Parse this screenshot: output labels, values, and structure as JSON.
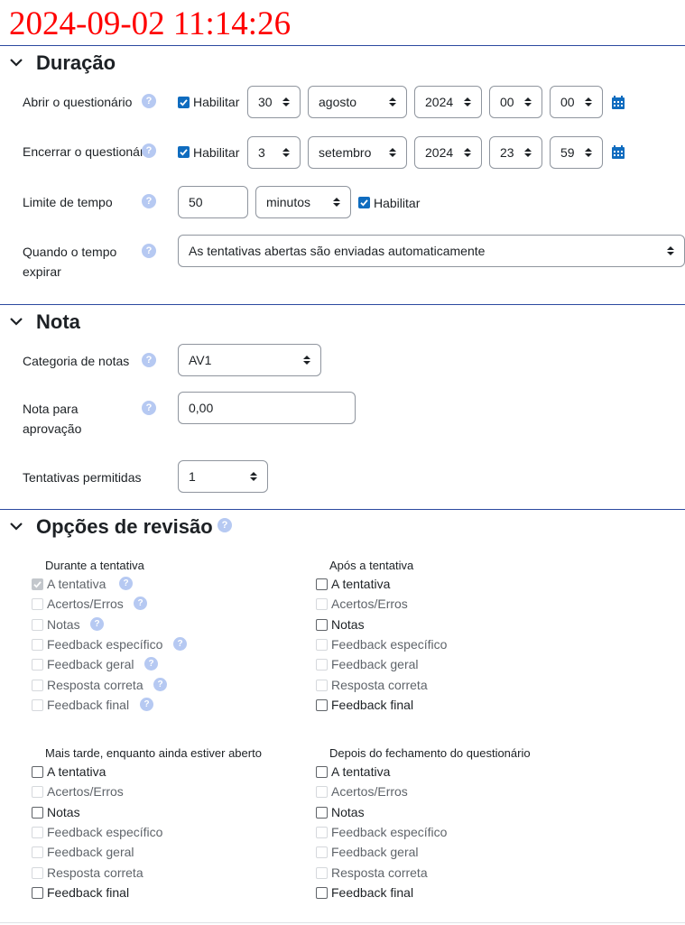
{
  "timestamp": "2024-09-02 11:14:26",
  "colors": {
    "timestamp": "#ff0000",
    "accent": "#0f6cbf",
    "divider": "#2c4aa0",
    "help_icon": "#b6c9f2"
  },
  "duracao": {
    "title": "Duração",
    "abrir": {
      "label": "Abrir o questionário",
      "enable_checked": true,
      "enable_label": "Habilitar",
      "day": "30",
      "month": "agosto",
      "year": "2024",
      "hour": "00",
      "minute": "00"
    },
    "encerrar": {
      "label": "Encerrar o questionário",
      "enable_checked": true,
      "enable_label": "Habilitar",
      "day": "3",
      "month": "setembro",
      "year": "2024",
      "hour": "23",
      "minute": "59"
    },
    "limite": {
      "label": "Limite de tempo",
      "value": "50",
      "unit": "minutos",
      "enable_checked": true,
      "enable_label": "Habilitar"
    },
    "expirar": {
      "label": "Quando o tempo expirar",
      "value": "As tentativas abertas são enviadas automaticamente"
    }
  },
  "nota": {
    "title": "Nota",
    "categoria": {
      "label": "Categoria de notas",
      "value": "AV1"
    },
    "aprovacao": {
      "label": "Nota para aprovação",
      "value": "0,00"
    },
    "tentativas": {
      "label": "Tentativas permitidas",
      "value": "1"
    }
  },
  "revisao": {
    "title": "Opções de revisão",
    "groups": [
      {
        "title": "Durante a tentativa",
        "items": [
          {
            "label": "A tentativa",
            "state": "checked-disabled",
            "help": true
          },
          {
            "label": "Acertos/Erros",
            "state": "disabled",
            "help": true
          },
          {
            "label": "Notas",
            "state": "disabled",
            "help": true
          },
          {
            "label": "Feedback específico",
            "state": "disabled",
            "help": true
          },
          {
            "label": "Feedback geral",
            "state": "disabled",
            "help": true
          },
          {
            "label": "Resposta correta",
            "state": "disabled",
            "help": true
          },
          {
            "label": "Feedback final",
            "state": "disabled",
            "help": true
          }
        ]
      },
      {
        "title": "Após a tentativa",
        "items": [
          {
            "label": "A tentativa",
            "state": "unchecked"
          },
          {
            "label": "Acertos/Erros",
            "state": "disabled"
          },
          {
            "label": "Notas",
            "state": "unchecked"
          },
          {
            "label": "Feedback específico",
            "state": "disabled"
          },
          {
            "label": "Feedback geral",
            "state": "disabled"
          },
          {
            "label": "Resposta correta",
            "state": "disabled"
          },
          {
            "label": "Feedback final",
            "state": "unchecked"
          }
        ]
      },
      {
        "title": "Mais tarde, enquanto ainda estiver aberto",
        "items": [
          {
            "label": "A tentativa",
            "state": "unchecked"
          },
          {
            "label": "Acertos/Erros",
            "state": "disabled"
          },
          {
            "label": "Notas",
            "state": "unchecked"
          },
          {
            "label": "Feedback específico",
            "state": "disabled"
          },
          {
            "label": "Feedback geral",
            "state": "disabled"
          },
          {
            "label": "Resposta correta",
            "state": "disabled"
          },
          {
            "label": "Feedback final",
            "state": "unchecked"
          }
        ]
      },
      {
        "title": "Depois do fechamento do questionário",
        "items": [
          {
            "label": "A tentativa",
            "state": "unchecked"
          },
          {
            "label": "Acertos/Erros",
            "state": "disabled"
          },
          {
            "label": "Notas",
            "state": "unchecked"
          },
          {
            "label": "Feedback específico",
            "state": "disabled"
          },
          {
            "label": "Feedback geral",
            "state": "disabled"
          },
          {
            "label": "Resposta correta",
            "state": "disabled"
          },
          {
            "label": "Feedback final",
            "state": "unchecked"
          }
        ]
      }
    ]
  }
}
